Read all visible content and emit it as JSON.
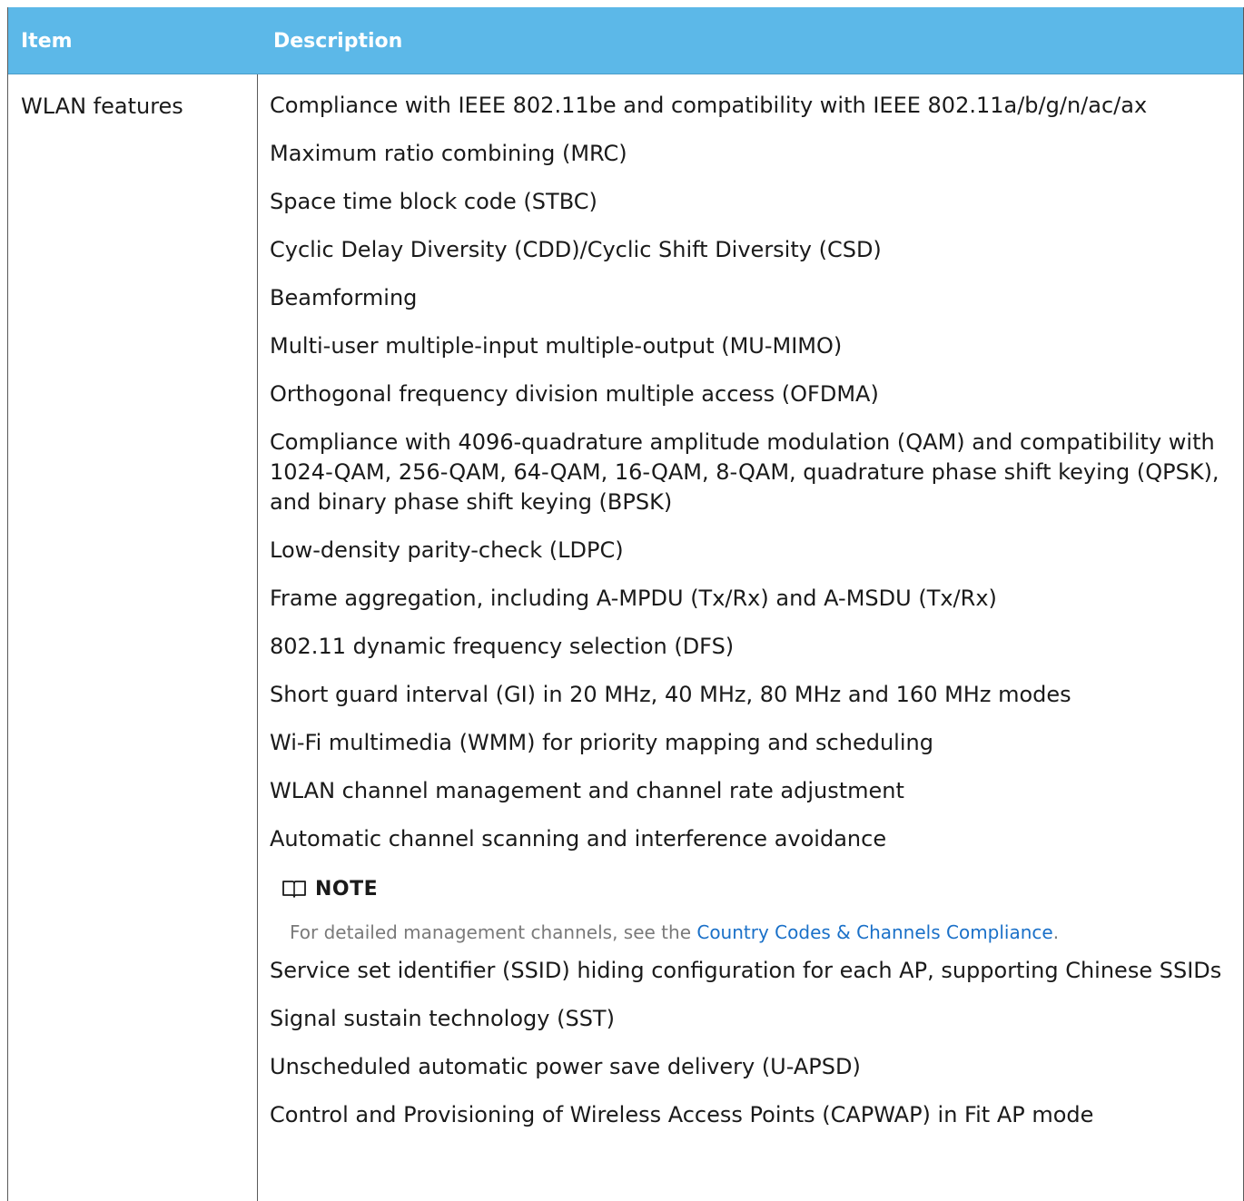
{
  "table": {
    "headers": [
      "Item",
      "Description"
    ],
    "rows": [
      {
        "item": "WLAN features",
        "description": [
          "Compliance with IEEE 802.11be and compatibility with IEEE 802.11a/b/g/n/ac/ax",
          "Maximum ratio combining (MRC)",
          "Space time block code (STBC)",
          "Cyclic Delay Diversity (CDD)/Cyclic Shift Diversity (CSD)",
          "Beamforming",
          "Multi-user multiple-input multiple-output (MU-MIMO)",
          "Orthogonal frequency division multiple access (OFDMA)",
          "Compliance with 4096-quadrature amplitude modulation (QAM) and compatibility with 1024-QAM, 256-QAM, 64-QAM, 16-QAM, 8-QAM, quadrature phase shift keying (QPSK), and binary phase shift keying (BPSK)",
          "Low-density parity-check (LDPC)",
          "Frame aggregation, including A-MPDU (Tx/Rx) and A-MSDU (Tx/Rx)",
          "802.11 dynamic frequency selection (DFS)",
          "Short guard interval (GI) in 20 MHz, 40 MHz, 80 MHz and 160 MHz modes",
          "Wi-Fi multimedia (WMM) for priority mapping and scheduling",
          "WLAN channel management and channel rate adjustment",
          "Automatic channel scanning and interference avoidance"
        ],
        "note": {
          "label": "NOTE",
          "text_before": "For detailed management channels, see the ",
          "link_text": "Country Codes & Channels Compliance",
          "text_after": "."
        },
        "description_after_note": [
          "Service set identifier (SSID) hiding configuration for each AP, supporting Chinese SSIDs",
          "Signal sustain technology (SST)",
          "Unscheduled automatic power save delivery (U-APSD)",
          "Control and Provisioning of Wireless Access Points (CAPWAP) in Fit AP mode"
        ]
      }
    ]
  },
  "icons": {
    "note": "book-icon"
  },
  "colors": {
    "header_bg": "#5cb8e8",
    "link": "#1a70c8",
    "note_text": "#7a7a7a"
  }
}
